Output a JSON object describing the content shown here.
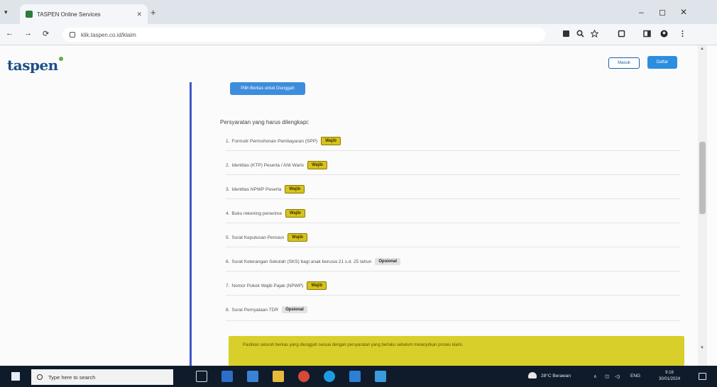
{
  "browser": {
    "tab_title": "TASPEN Online Services",
    "address": "klik.taspen.co.id/klaim",
    "new_tab": "+",
    "minimize": "–",
    "maximize": "◻",
    "close": "✕",
    "tab_close": "✕",
    "tab_menu": "▾",
    "back": "←",
    "forward": "→",
    "reload": "⟳"
  },
  "header": {
    "logo": "taspen",
    "secondary_button": "Masuk",
    "primary_button": "Daftar"
  },
  "upload_button": "Pilih Berkas untuk Diunggah",
  "requirements": {
    "title": "Persyaratan yang harus dilengkapi:",
    "items": [
      {
        "num": "1.",
        "text": "Formulir Permohonan Pembayaran (SPP)",
        "badge": "Wajib",
        "badge_type": "wajib"
      },
      {
        "num": "2.",
        "text": "Identitas (KTP) Peserta / Ahli Waris",
        "badge": "Wajib",
        "badge_type": "wajib"
      },
      {
        "num": "3.",
        "text": "Identitas NPWP Peserta",
        "badge": "Wajib",
        "badge_type": "wajib"
      },
      {
        "num": "4.",
        "text": "Buku rekening penerima",
        "badge": "Wajib",
        "badge_type": "wajib"
      },
      {
        "num": "5.",
        "text": "Surat Keputusan Pensiun",
        "badge": "Wajib",
        "badge_type": "wajib"
      },
      {
        "num": "6.",
        "text": "Surat Keterangan Sekolah (SKS) bagi anak berusia 21 s.d. 25 tahun",
        "badge": "Opsional",
        "badge_type": "opsional"
      },
      {
        "num": "7.",
        "text": "Nomor Pokok Wajib Pajak (NPWP)",
        "badge": "Wajib",
        "badge_type": "wajib"
      },
      {
        "num": "8.",
        "text": "Surat Pernyataan TDR",
        "badge": "Opsional",
        "badge_type": "opsional"
      }
    ]
  },
  "notice": "Pastikan seluruh berkas yang diunggah sesuai dengan persyaratan yang berlaku sebelum melanjutkan proses klaim.",
  "taskbar": {
    "search_placeholder": "Type here to search",
    "weather": "28°C Berawan",
    "tray": "ENG",
    "time": "9:16",
    "date": "30/01/2024"
  }
}
